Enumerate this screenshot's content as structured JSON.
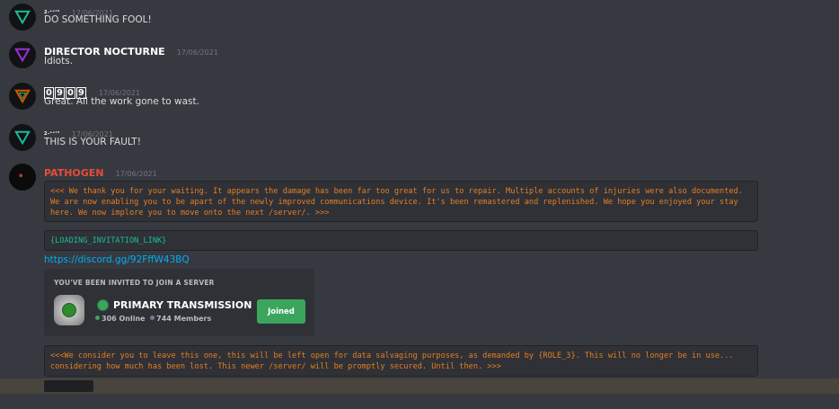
{
  "messages": [
    {
      "author": "2-ᵉᵉ⁷²",
      "timestamp": "17/06/2021",
      "text": "DO SOMETHING FOOL!",
      "icon": "triangle-teal-icon",
      "color": "#1abc9c"
    },
    {
      "author": "DIRECTOR NOCTURNE",
      "timestamp": "17/06/2021",
      "text": "Idiots.",
      "icon": "triangle-purple-icon",
      "color": "#8e44ad"
    },
    {
      "author_chars": [
        "0",
        "9",
        "0",
        "9"
      ],
      "timestamp": "17/06/2021",
      "text": "Great. All the work gone to wast.",
      "icon": "triangle-orange-icon",
      "color": "#d35400"
    },
    {
      "author": "2-ᵉᵉ⁷²",
      "timestamp": "17/06/2021",
      "text": "THIS IS YOUR FAULT!",
      "icon": "triangle-teal-icon",
      "color": "#1abc9c"
    }
  ],
  "pathogen": {
    "author": "PATHOGEN",
    "author_color": "#e74c3c",
    "timestamp": "17/06/2021",
    "code1": "<<< We thank you for your waiting. It appears the damage has been far too great for us to repair. Multiple accounts of injuries were also documented. We are now enabling you to be apart of the newly improved communications device. It's been remastered and replenished. We hope you enjoyed your stay here. We now implore you to move onto the next /server/. >>>",
    "code2": "{LOADING_INVITATION_LINK}",
    "link": "https://discord.gg/92FffW43BQ",
    "invite": {
      "title": "You've been invited to join a server",
      "server_name": "PRIMARY TRANSMISSION",
      "online": "306 Online",
      "members": "744 Members",
      "button": "Joined"
    },
    "code3": "<<<We consider you to leave this one, this will be left open for data salvaging purposes, as demanded by {ROLE_3}. This will no longer be in use... considering how much has been lost. This newer /server/ will be promptly secured. Until then. >>>"
  }
}
